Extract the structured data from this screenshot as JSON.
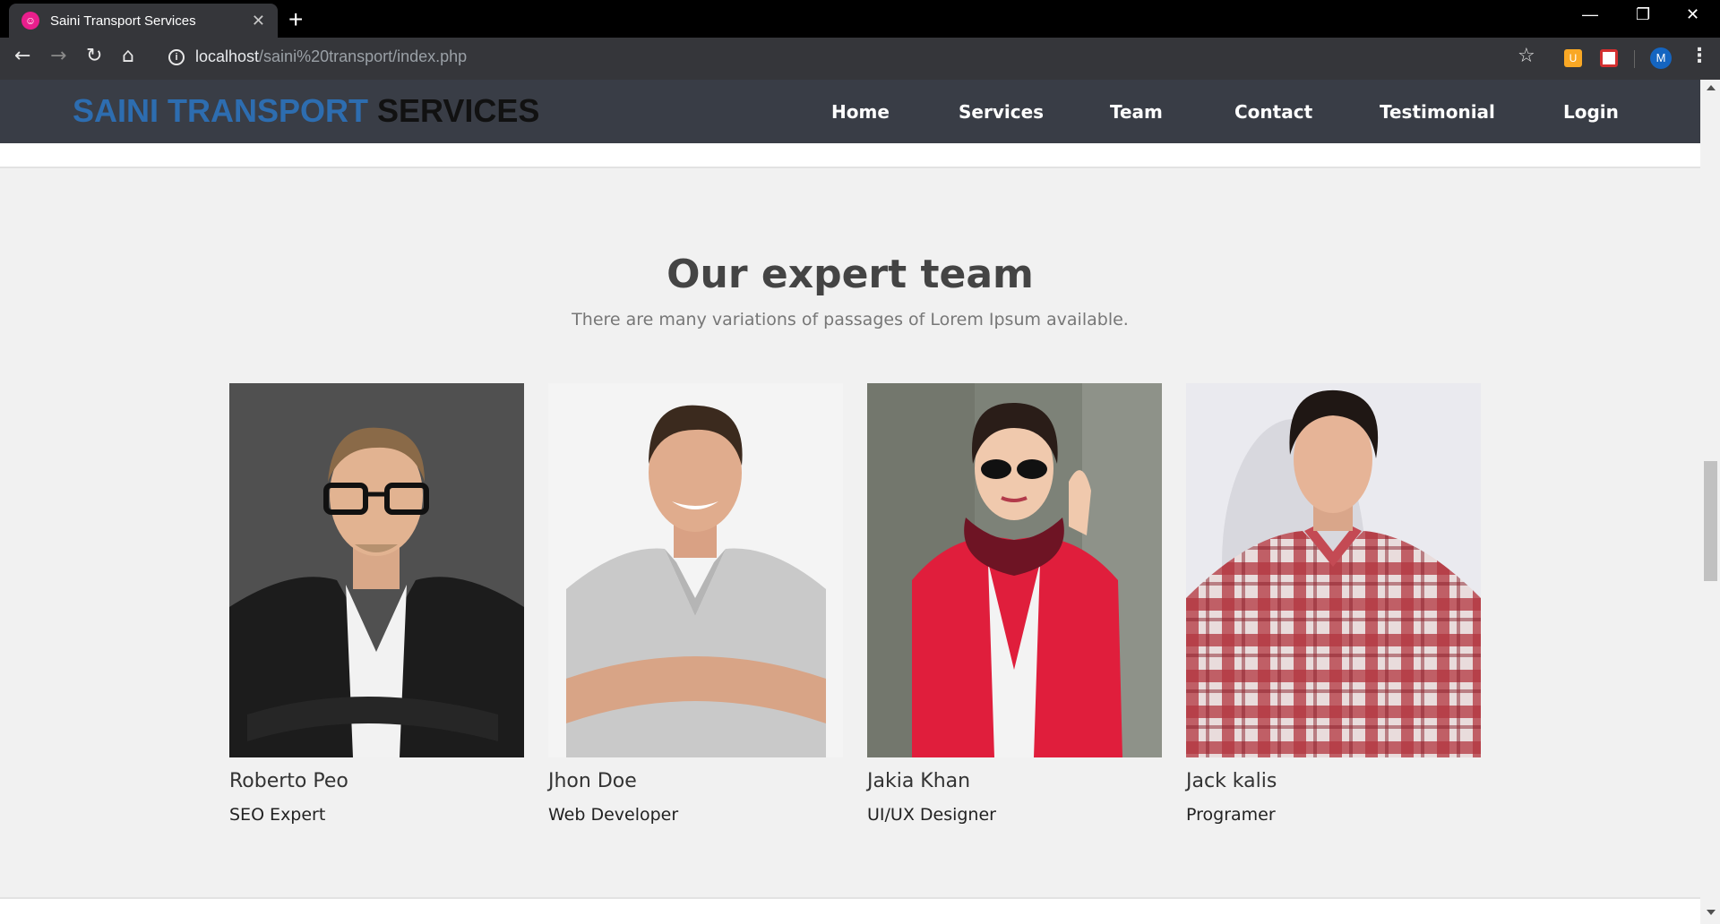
{
  "browser": {
    "tab_title": "Saini Transport Services",
    "tab_favicon_glyph": "☺",
    "tab_close": "✕",
    "new_tab": "+",
    "url_host": "localhost",
    "url_path": "/saini%20transport/index.php",
    "profile_initial": "M"
  },
  "site": {
    "brand_part1": "SAINI TRANSPORT",
    "brand_part2": "SERVICES",
    "nav": [
      "Home",
      "Services",
      "Team",
      "Contact",
      "Testimonial",
      "Login"
    ]
  },
  "team": {
    "title": "Our expert team",
    "subtitle": "There are many variations of passages of Lorem Ipsum available.",
    "members": [
      {
        "name": "Roberto Peo",
        "role": "SEO Expert"
      },
      {
        "name": "Jhon Doe",
        "role": "Web Developer"
      },
      {
        "name": "Jakia Khan",
        "role": "UI/UX Designer"
      },
      {
        "name": "Jack kalis",
        "role": "Programer"
      }
    ]
  },
  "colors": {
    "header_bg": "#393d46",
    "brand_blue": "#2d6db0",
    "page_bg": "#f1f1f1"
  }
}
